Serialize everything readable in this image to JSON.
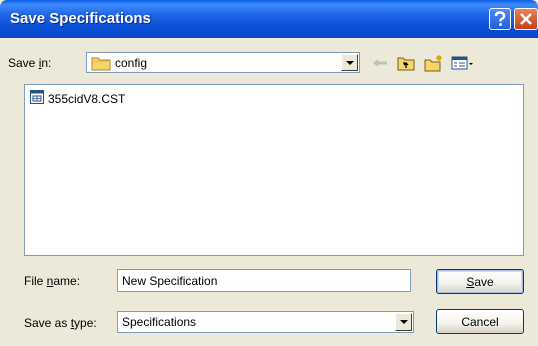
{
  "window": {
    "title": "Save Specifications"
  },
  "save_in": {
    "label_pre": "Save ",
    "label_underlined": "i",
    "label_post": "n:",
    "value": "config"
  },
  "files": [
    {
      "name": "355cidV8.CST"
    }
  ],
  "file_name": {
    "label_pre": "File ",
    "label_underlined": "n",
    "label_post": "ame:",
    "value": "New Specification"
  },
  "save_as_type": {
    "label_pre": "Save as ",
    "label_underlined": "t",
    "label_post": "ype:",
    "value": "Specifications"
  },
  "buttons": {
    "save_underlined": "S",
    "save_rest": "ave",
    "cancel": "Cancel"
  },
  "colors": {
    "titlebar": "#0A46C4",
    "dialog_bg": "#ECE9D8",
    "field_border": "#7F9DB9",
    "close_button": "#C4401C",
    "help_button": "#1F5FDB"
  },
  "icons": {
    "help": "question-mark-icon",
    "close": "close-icon",
    "folder": "folder-icon",
    "back": "back-arrow-icon",
    "up": "up-one-level-icon",
    "new_folder": "new-folder-icon",
    "view_menu": "view-menu-icon",
    "file": "file-icon"
  }
}
